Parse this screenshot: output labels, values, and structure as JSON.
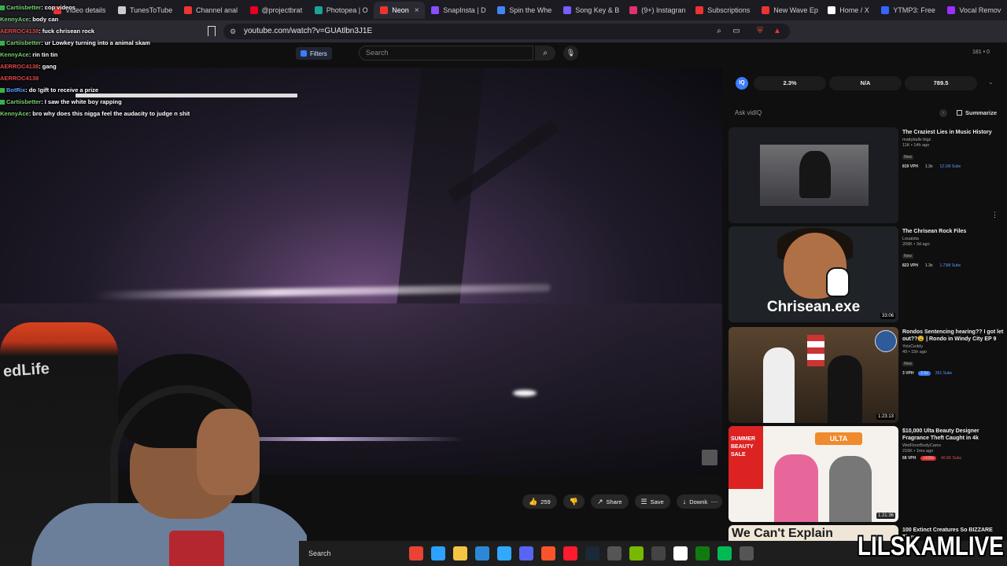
{
  "tabs": [
    {
      "label": "Video details",
      "color": "#e33"
    },
    {
      "label": "TunesToTube",
      "color": "#ccc"
    },
    {
      "label": "Channel anal",
      "color": "#e33"
    },
    {
      "label": "@projectbrat",
      "color": "#e60023"
    },
    {
      "label": "Photopea | O",
      "color": "#18a497"
    },
    {
      "label": "Neon",
      "color": "#e33",
      "active": true
    },
    {
      "label": "SnapInsta | D",
      "color": "#8a4dff"
    },
    {
      "label": "Spin the Whe",
      "color": "#4285f4"
    },
    {
      "label": "Song Key & B",
      "color": "#7a5cff"
    },
    {
      "label": "(9+) Instagran",
      "color": "#e1306c"
    },
    {
      "label": "Subscriptions",
      "color": "#e33"
    },
    {
      "label": "New Wave Ep",
      "color": "#e33"
    },
    {
      "label": "Home / X",
      "color": "#fff"
    },
    {
      "label": "YTMP3: Free",
      "color": "#3366ff"
    },
    {
      "label": "Vocal Remov",
      "color": "#9b30ff"
    }
  ],
  "address": {
    "url": "youtube.com/watch?v=GUAtlbn3J1E"
  },
  "header": {
    "filters_label": "Filters",
    "search_placeholder": "Search",
    "right_stats": "181 • 0"
  },
  "chat": [
    {
      "user": "Cartiisbetter",
      "msg": ": cop videos",
      "color": "green"
    },
    {
      "user": "KennyAce",
      "msg": ": body can",
      "color": "green"
    },
    {
      "user": "AERROC4138",
      "msg": ": fuck chrisean rock",
      "color": "red"
    },
    {
      "user": "Cartiisbetter",
      "msg": ": ur Lowkey turning into a animal skam",
      "color": "green"
    },
    {
      "user": "KennyAce",
      "msg": ": rin tin tin",
      "color": "green"
    },
    {
      "user": "AERROC4138",
      "msg": ": gang",
      "color": "red"
    },
    {
      "user": "AERROC4138",
      "msg": "",
      "color": "red"
    },
    {
      "user": "BotRix",
      "msg": ": do !gift to receive a prize",
      "color": "blue"
    },
    {
      "user": "Cartiisbetter",
      "msg": ": I saw the white boy rapping",
      "color": "green"
    },
    {
      "user": "KennyAce",
      "msg": ": bro why does this nigga feel the audacity to judge n shit",
      "color": "green"
    }
  ],
  "webcam": {
    "chair_logo": "edLife"
  },
  "actions": {
    "like_count": "259",
    "share": "Share",
    "save": "Save",
    "download": "Download"
  },
  "vidiq": {
    "logo": "IQ",
    "stat1": "2.3%",
    "stat2": "N/A",
    "stat3": "789.5",
    "ask_placeholder": "Ask vidIQ",
    "summarize": "Summarize"
  },
  "recommended": [
    {
      "title": "The Craziest Lies in Music History",
      "channel": "mattyballs bigz",
      "meta": "11K • 14h ago",
      "new": "New",
      "vph": "819 VPH",
      "mult": "1.3x",
      "subs": "12.1M Subs",
      "duration": ""
    },
    {
      "title": "The Chrisean Rock Files",
      "channel": "Louaista",
      "meta": "209K • 3d ago",
      "new": "New",
      "vph": "823 VPH",
      "mult": "1.3x",
      "subs": "1.73M Subs",
      "duration": "33:06",
      "caption": "Chrisean.exe"
    },
    {
      "title": "Rondos Sentencing hearing?? I got let out??😩 | Rondo in Windy City EP 9",
      "channel": "YolzCeddy",
      "meta": "49 • 15h ago",
      "new": "New",
      "vph": "3 VPH",
      "mult": "2.5x",
      "subs": "261 Subs",
      "duration": "1:23:13"
    },
    {
      "title": "$10,000 Ulta Beauty Designer Fragrance Theft Caught in 4k",
      "channel": "WetFloorBodyCams",
      "meta": "216K • 1mo ago",
      "new": "",
      "vph": "68 VPH",
      "mult": ">100x",
      "subs": "40.6K Subs",
      "duration": "1:21:36",
      "sale_text": "SUMMER BEAUTY SALE",
      "brand": "ULTA"
    },
    {
      "title": "100 Extinct Creatures So BIZZARE They",
      "channel": "",
      "meta": "",
      "new": "",
      "vph": "",
      "mult": "",
      "subs": "",
      "duration": "",
      "caption": "We Can't Explain"
    }
  ],
  "taskbar": {
    "search_label": "Search",
    "icons": [
      "chrome-icon",
      "copilot-icon",
      "files-icon",
      "store-icon",
      "photoshop-icon",
      "discord-icon",
      "brave-icon",
      "opera-icon",
      "steam-icon",
      "app-icon",
      "nvidia-icon",
      "4k-icon",
      "capcut-icon",
      "xbox-icon",
      "app2-icon",
      "app3-icon"
    ]
  },
  "watermark": "LILSKAMLIVE"
}
